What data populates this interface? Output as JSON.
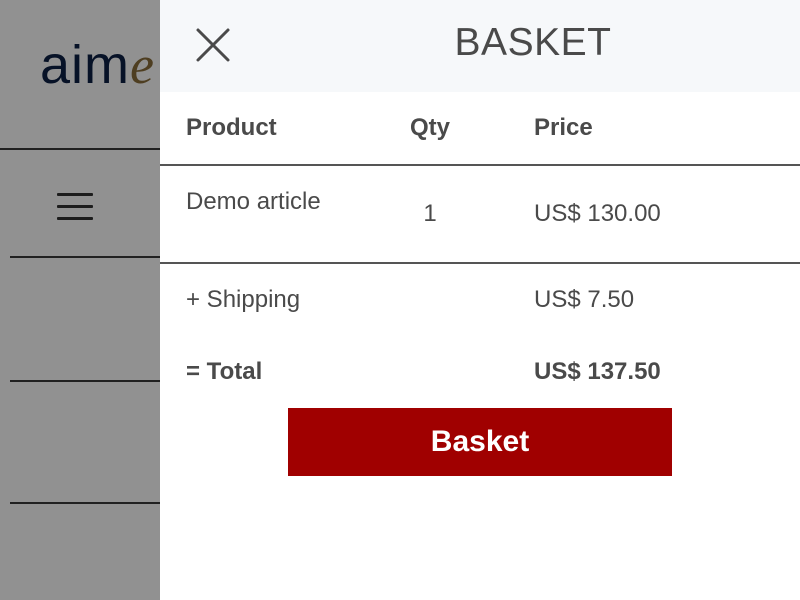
{
  "page": {
    "logo": {
      "main": "aim",
      "accent": "e"
    },
    "menu_icon": "hamburger-icon"
  },
  "basket": {
    "title": "BASKET",
    "close_icon": "close-icon",
    "columns": {
      "product": "Product",
      "qty": "Qty",
      "price": "Price"
    },
    "items": [
      {
        "product": "Demo article",
        "qty": "1",
        "price": "US$ 130.00"
      }
    ],
    "shipping": {
      "label": "+ Shipping",
      "price": "US$ 7.50"
    },
    "total": {
      "label": "= Total",
      "price": "US$ 137.50"
    },
    "button_label": "Basket"
  },
  "colors": {
    "button_bg": "#a00000",
    "drawer_header_bg": "#f6f8fa",
    "logo_navy": "#0d2145",
    "logo_gold": "#8a6d3b",
    "overlay": "rgba(0,0,0,0.43)"
  }
}
